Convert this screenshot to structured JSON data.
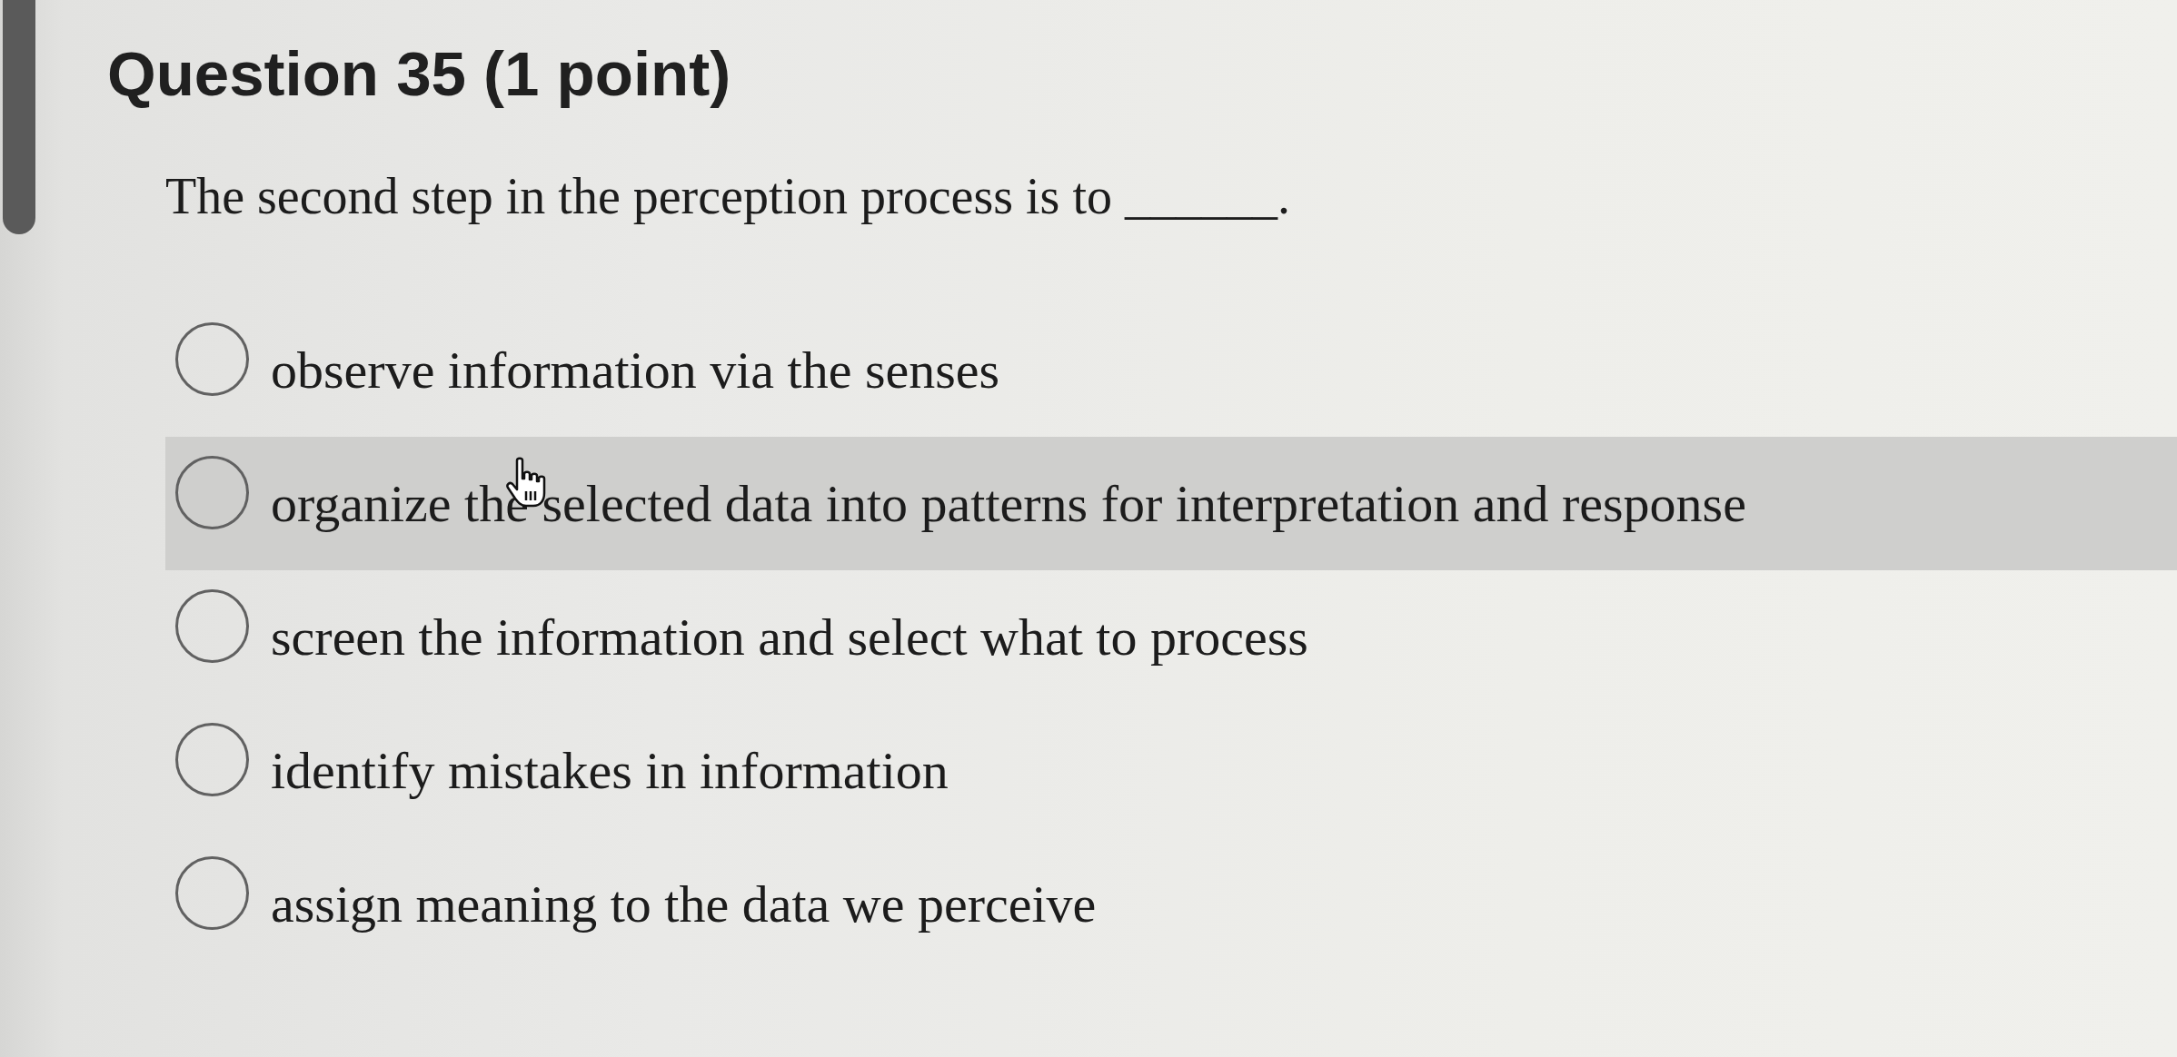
{
  "question": {
    "title": "Question 35 (1 point)",
    "prompt": "The second step in the perception process is to ______."
  },
  "options": [
    {
      "label": "observe information via the senses",
      "selected": false,
      "hovered": false
    },
    {
      "label": "organize the selected data into patterns for interpretation and response",
      "selected": false,
      "hovered": true
    },
    {
      "label": "screen the information and select what to process",
      "selected": false,
      "hovered": false
    },
    {
      "label": "identify mistakes in information",
      "selected": false,
      "hovered": false
    },
    {
      "label": "assign meaning to the data we perceive",
      "selected": false,
      "hovered": false
    }
  ]
}
